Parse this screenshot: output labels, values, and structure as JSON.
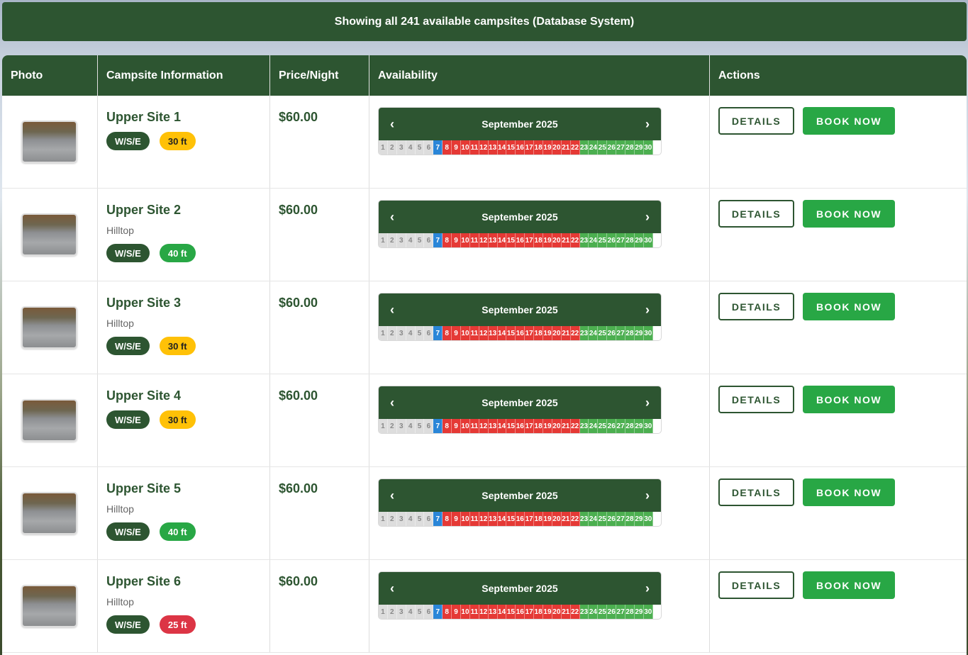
{
  "banner": {
    "text": "Showing all 241 available campsites (Database System)"
  },
  "columns": [
    "Photo",
    "Campsite Information",
    "Price/Night",
    "Availability",
    "Actions"
  ],
  "colors": {
    "primary": "#2d5531",
    "book": "#28a745",
    "booked": "#e53935",
    "available": "#4caf50",
    "today": "#2a86d8",
    "past": "#dddddd"
  },
  "calendar": {
    "month_label": "September 2025",
    "prev": "‹",
    "next": "›"
  },
  "buttons": {
    "details": "DETAILS",
    "book": "BOOK NOW"
  },
  "sites": [
    {
      "name": "Upper Site 1",
      "location": "",
      "hookup": "W/S/E",
      "length": "30 ft",
      "length_color": "#ffc107",
      "length_text_color": "#222",
      "price": "$60.00"
    },
    {
      "name": "Upper Site 2",
      "location": "Hilltop",
      "hookup": "W/S/E",
      "length": "40 ft",
      "length_color": "#28a745",
      "length_text_color": "#fff",
      "price": "$60.00"
    },
    {
      "name": "Upper Site 3",
      "location": "Hilltop",
      "hookup": "W/S/E",
      "length": "30 ft",
      "length_color": "#ffc107",
      "length_text_color": "#222",
      "price": "$60.00"
    },
    {
      "name": "Upper Site 4",
      "location": "",
      "hookup": "W/S/E",
      "length": "30 ft",
      "length_color": "#ffc107",
      "length_text_color": "#222",
      "price": "$60.00"
    },
    {
      "name": "Upper Site 5",
      "location": "Hilltop",
      "hookup": "W/S/E",
      "length": "40 ft",
      "length_color": "#28a745",
      "length_text_color": "#fff",
      "price": "$60.00"
    },
    {
      "name": "Upper Site 6",
      "location": "Hilltop",
      "hookup": "W/S/E",
      "length": "25 ft",
      "length_color": "#dc3545",
      "length_text_color": "#fff",
      "price": "$60.00"
    }
  ]
}
